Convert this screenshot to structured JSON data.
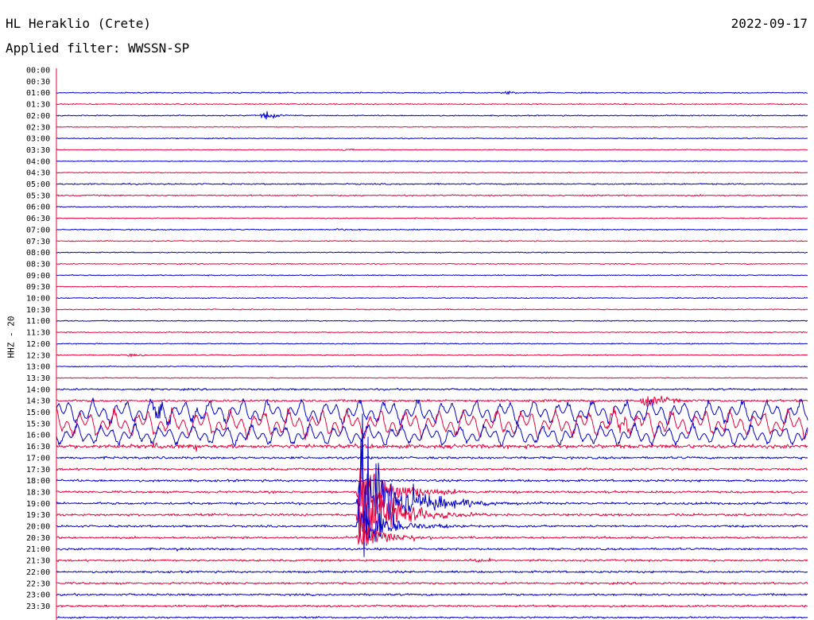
{
  "header": {
    "station": "HL Heraklio (Crete)",
    "date": "2022-09-17",
    "filter_label": "Applied filter:",
    "filter_name": "WWSSN-SP"
  },
  "chart_data": {
    "type": "line",
    "title": "HL Heraklio (Crete)",
    "date": "2022-09-17",
    "filter": "WWSSN-SP",
    "ylabel": "HHZ - 20",
    "xlabel": "",
    "row_interval_minutes": 30,
    "colors": [
      "#0000cc",
      "#e8003a"
    ],
    "rows": [
      {
        "time": "00:00",
        "amp": 0
      },
      {
        "time": "00:30",
        "amp": 0
      },
      {
        "time": "01:00",
        "amp": 1.0,
        "events": [
          {
            "pos": 0.6,
            "amp": 4,
            "width": 0.01
          }
        ]
      },
      {
        "time": "01:30",
        "amp": 1.0
      },
      {
        "time": "02:00",
        "amp": 1.0,
        "events": [
          {
            "pos": 0.28,
            "amp": 8,
            "width": 0.012
          }
        ]
      },
      {
        "time": "02:30",
        "amp": 0.8
      },
      {
        "time": "03:00",
        "amp": 0.8
      },
      {
        "time": "03:30",
        "amp": 0.8,
        "events": [
          {
            "pos": 0.385,
            "amp": 2,
            "width": 0.01
          }
        ]
      },
      {
        "time": "04:00",
        "amp": 0.8
      },
      {
        "time": "04:30",
        "amp": 0.8
      },
      {
        "time": "05:00",
        "amp": 1.2
      },
      {
        "time": "05:30",
        "amp": 1.2
      },
      {
        "time": "06:00",
        "amp": 0.9
      },
      {
        "time": "06:30",
        "amp": 0.9
      },
      {
        "time": "07:00",
        "amp": 1.0,
        "events": [
          {
            "pos": 0.375,
            "amp": 2.5,
            "width": 0.01
          }
        ]
      },
      {
        "time": "07:30",
        "amp": 0.9
      },
      {
        "time": "08:00",
        "amp": 0.9
      },
      {
        "time": "08:30",
        "amp": 0.9
      },
      {
        "time": "09:00",
        "amp": 0.9
      },
      {
        "time": "09:30",
        "amp": 0.9
      },
      {
        "time": "10:00",
        "amp": 0.9
      },
      {
        "time": "10:30",
        "amp": 0.9
      },
      {
        "time": "11:00",
        "amp": 0.9
      },
      {
        "time": "11:30",
        "amp": 0.9
      },
      {
        "time": "12:00",
        "amp": 0.9
      },
      {
        "time": "12:30",
        "amp": 1.0,
        "events": [
          {
            "pos": 0.1,
            "amp": 3,
            "width": 0.012
          }
        ]
      },
      {
        "time": "13:00",
        "amp": 0.9
      },
      {
        "time": "13:30",
        "amp": 0.9
      },
      {
        "time": "14:00",
        "amp": 1.6
      },
      {
        "time": "14:30",
        "amp": 2.0,
        "events": [
          {
            "pos": 0.79,
            "amp": 14,
            "width": 0.02
          }
        ]
      },
      {
        "time": "15:00",
        "amp": 14,
        "events": [
          {
            "pos": 0.135,
            "amp": 20,
            "width": 0.01
          },
          {
            "pos": 0.185,
            "amp": 14,
            "width": 0.008
          }
        ]
      },
      {
        "time": "15:30",
        "amp": 16,
        "events": [
          {
            "pos": 0.75,
            "amp": 12,
            "width": 0.03
          }
        ]
      },
      {
        "time": "16:00",
        "amp": 12
      },
      {
        "time": "16:30",
        "amp": 3.5,
        "events": [
          {
            "pos": 0.135,
            "amp": 8,
            "width": 0.01
          },
          {
            "pos": 0.185,
            "amp": 7,
            "width": 0.008
          }
        ]
      },
      {
        "time": "17:00",
        "amp": 2.0
      },
      {
        "time": "17:30",
        "amp": 2.0
      },
      {
        "time": "18:00",
        "amp": 2.0
      },
      {
        "time": "18:30",
        "amp": 2.0
      },
      {
        "time": "19:00",
        "amp": 2.0
      },
      {
        "time": "19:30",
        "amp": 2.0
      },
      {
        "time": "20:00",
        "amp": 1.8
      },
      {
        "time": "20:30",
        "amp": 1.8
      },
      {
        "time": "21:00",
        "amp": 1.8,
        "events": [
          {
            "pos": 0.16,
            "amp": 2.5,
            "width": 0.01
          }
        ]
      },
      {
        "time": "21:30",
        "amp": 1.8,
        "events": [
          {
            "pos": 0.56,
            "amp": 5,
            "width": 0.015
          }
        ]
      },
      {
        "time": "22:00",
        "amp": 1.8
      },
      {
        "time": "22:30",
        "amp": 1.8
      },
      {
        "time": "23:00",
        "amp": 1.8
      },
      {
        "time": "23:30",
        "amp": 1.8
      },
      {
        "time": "",
        "amp": 1.5
      }
    ],
    "quake": {
      "row": "19:00",
      "pos": 0.402,
      "peak_amp": 150,
      "decay": 0.045
    }
  }
}
